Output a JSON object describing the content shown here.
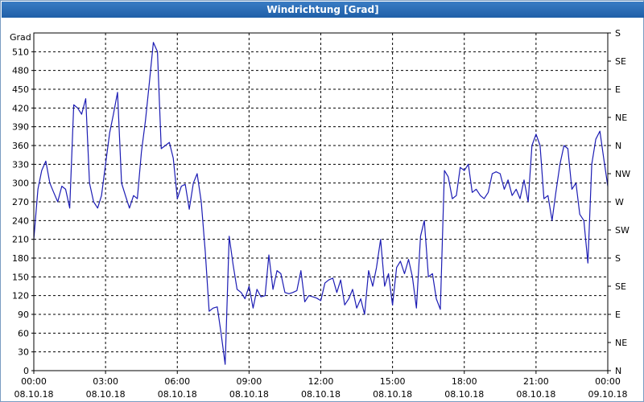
{
  "window": {
    "title": "Windrichtung [Grad]"
  },
  "colors": {
    "titlebar": "#2b6cb5",
    "line": "#1c1cb4",
    "grid": "#000000"
  },
  "chart_data": {
    "type": "line",
    "title": "Windrichtung [Grad]",
    "ylabel": "Grad",
    "ylim": [
      0,
      540
    ],
    "grid": true,
    "y_ticks": [
      "0",
      "30",
      "60",
      "90",
      "120",
      "150",
      "180",
      "210",
      "240",
      "270",
      "300",
      "330",
      "360",
      "390",
      "420",
      "450",
      "480",
      "510"
    ],
    "x_ticks": [
      {
        "time": "00:00",
        "date": "08.10.18"
      },
      {
        "time": "03:00",
        "date": "08.10.18"
      },
      {
        "time": "06:00",
        "date": "08.10.18"
      },
      {
        "time": "09:00",
        "date": "08.10.18"
      },
      {
        "time": "12:00",
        "date": "08.10.18"
      },
      {
        "time": "15:00",
        "date": "08.10.18"
      },
      {
        "time": "18:00",
        "date": "08.10.18"
      },
      {
        "time": "21:00",
        "date": "08.10.18"
      },
      {
        "time": "00:00",
        "date": "09.10.18"
      }
    ],
    "right_labels": [
      {
        "value": 0,
        "label": "N"
      },
      {
        "value": 45,
        "label": "NE"
      },
      {
        "value": 90,
        "label": "E"
      },
      {
        "value": 135,
        "label": "SE"
      },
      {
        "value": 180,
        "label": "S"
      },
      {
        "value": 225,
        "label": "SW"
      },
      {
        "value": 270,
        "label": "W"
      },
      {
        "value": 315,
        "label": "NW"
      },
      {
        "value": 360,
        "label": "N"
      },
      {
        "value": 405,
        "label": "NE"
      },
      {
        "value": 450,
        "label": "E"
      },
      {
        "value": 495,
        "label": "SE"
      },
      {
        "value": 540,
        "label": "S"
      }
    ],
    "series": [
      {
        "x_unit": "hours since 08.10.18 00:00",
        "points": [
          [
            0.0,
            210
          ],
          [
            0.17,
            290
          ],
          [
            0.33,
            320
          ],
          [
            0.5,
            335
          ],
          [
            0.67,
            300
          ],
          [
            0.83,
            285
          ],
          [
            1.0,
            270
          ],
          [
            1.17,
            295
          ],
          [
            1.33,
            290
          ],
          [
            1.5,
            260
          ],
          [
            1.67,
            425
          ],
          [
            1.83,
            420
          ],
          [
            2.0,
            410
          ],
          [
            2.17,
            435
          ],
          [
            2.33,
            300
          ],
          [
            2.5,
            270
          ],
          [
            2.67,
            260
          ],
          [
            2.83,
            280
          ],
          [
            3.0,
            330
          ],
          [
            3.17,
            380
          ],
          [
            3.33,
            410
          ],
          [
            3.5,
            445
          ],
          [
            3.67,
            300
          ],
          [
            3.83,
            280
          ],
          [
            4.0,
            260
          ],
          [
            4.17,
            280
          ],
          [
            4.33,
            275
          ],
          [
            4.5,
            350
          ],
          [
            4.67,
            400
          ],
          [
            4.83,
            460
          ],
          [
            5.0,
            525
          ],
          [
            5.17,
            510
          ],
          [
            5.33,
            355
          ],
          [
            5.5,
            360
          ],
          [
            5.67,
            365
          ],
          [
            5.83,
            340
          ],
          [
            6.0,
            275
          ],
          [
            6.17,
            295
          ],
          [
            6.33,
            298
          ],
          [
            6.5,
            258
          ],
          [
            6.67,
            300
          ],
          [
            6.83,
            315
          ],
          [
            7.0,
            270
          ],
          [
            7.17,
            190
          ],
          [
            7.33,
            95
          ],
          [
            7.5,
            100
          ],
          [
            7.67,
            102
          ],
          [
            7.83,
            60
          ],
          [
            8.0,
            10
          ],
          [
            8.17,
            215
          ],
          [
            8.33,
            170
          ],
          [
            8.5,
            130
          ],
          [
            8.67,
            125
          ],
          [
            8.83,
            115
          ],
          [
            9.0,
            135
          ],
          [
            9.17,
            100
          ],
          [
            9.33,
            130
          ],
          [
            9.5,
            118
          ],
          [
            9.67,
            120
          ],
          [
            9.83,
            185
          ],
          [
            10.0,
            130
          ],
          [
            10.17,
            160
          ],
          [
            10.33,
            155
          ],
          [
            10.5,
            125
          ],
          [
            10.67,
            123
          ],
          [
            10.83,
            125
          ],
          [
            11.0,
            128
          ],
          [
            11.17,
            160
          ],
          [
            11.33,
            110
          ],
          [
            11.5,
            120
          ],
          [
            11.67,
            118
          ],
          [
            11.83,
            116
          ],
          [
            12.0,
            112
          ],
          [
            12.17,
            140
          ],
          [
            12.33,
            145
          ],
          [
            12.5,
            148
          ],
          [
            12.67,
            125
          ],
          [
            12.83,
            145
          ],
          [
            13.0,
            105
          ],
          [
            13.17,
            115
          ],
          [
            13.33,
            130
          ],
          [
            13.5,
            100
          ],
          [
            13.67,
            115
          ],
          [
            13.83,
            90
          ],
          [
            14.0,
            160
          ],
          [
            14.17,
            135
          ],
          [
            14.33,
            165
          ],
          [
            14.5,
            210
          ],
          [
            14.67,
            135
          ],
          [
            14.83,
            155
          ],
          [
            15.0,
            105
          ],
          [
            15.17,
            165
          ],
          [
            15.33,
            175
          ],
          [
            15.5,
            155
          ],
          [
            15.67,
            178
          ],
          [
            15.83,
            150
          ],
          [
            16.0,
            100
          ],
          [
            16.17,
            215
          ],
          [
            16.33,
            240
          ],
          [
            16.5,
            150
          ],
          [
            16.67,
            155
          ],
          [
            16.83,
            115
          ],
          [
            17.0,
            98
          ],
          [
            17.17,
            320
          ],
          [
            17.33,
            310
          ],
          [
            17.5,
            275
          ],
          [
            17.67,
            280
          ],
          [
            17.83,
            325
          ],
          [
            18.0,
            320
          ],
          [
            18.17,
            330
          ],
          [
            18.33,
            285
          ],
          [
            18.5,
            290
          ],
          [
            18.67,
            280
          ],
          [
            18.83,
            275
          ],
          [
            19.0,
            285
          ],
          [
            19.17,
            315
          ],
          [
            19.33,
            318
          ],
          [
            19.5,
            315
          ],
          [
            19.67,
            290
          ],
          [
            19.83,
            305
          ],
          [
            20.0,
            280
          ],
          [
            20.17,
            290
          ],
          [
            20.33,
            275
          ],
          [
            20.5,
            305
          ],
          [
            20.67,
            270
          ],
          [
            20.83,
            360
          ],
          [
            21.0,
            378
          ],
          [
            21.17,
            360
          ],
          [
            21.33,
            275
          ],
          [
            21.5,
            280
          ],
          [
            21.67,
            240
          ],
          [
            21.83,
            285
          ],
          [
            22.0,
            330
          ],
          [
            22.17,
            360
          ],
          [
            22.33,
            355
          ],
          [
            22.5,
            290
          ],
          [
            22.67,
            300
          ],
          [
            22.83,
            250
          ],
          [
            23.0,
            240
          ],
          [
            23.17,
            172
          ],
          [
            23.33,
            330
          ],
          [
            23.5,
            370
          ],
          [
            23.67,
            383
          ],
          [
            23.83,
            340
          ],
          [
            24.0,
            295
          ]
        ]
      }
    ]
  }
}
